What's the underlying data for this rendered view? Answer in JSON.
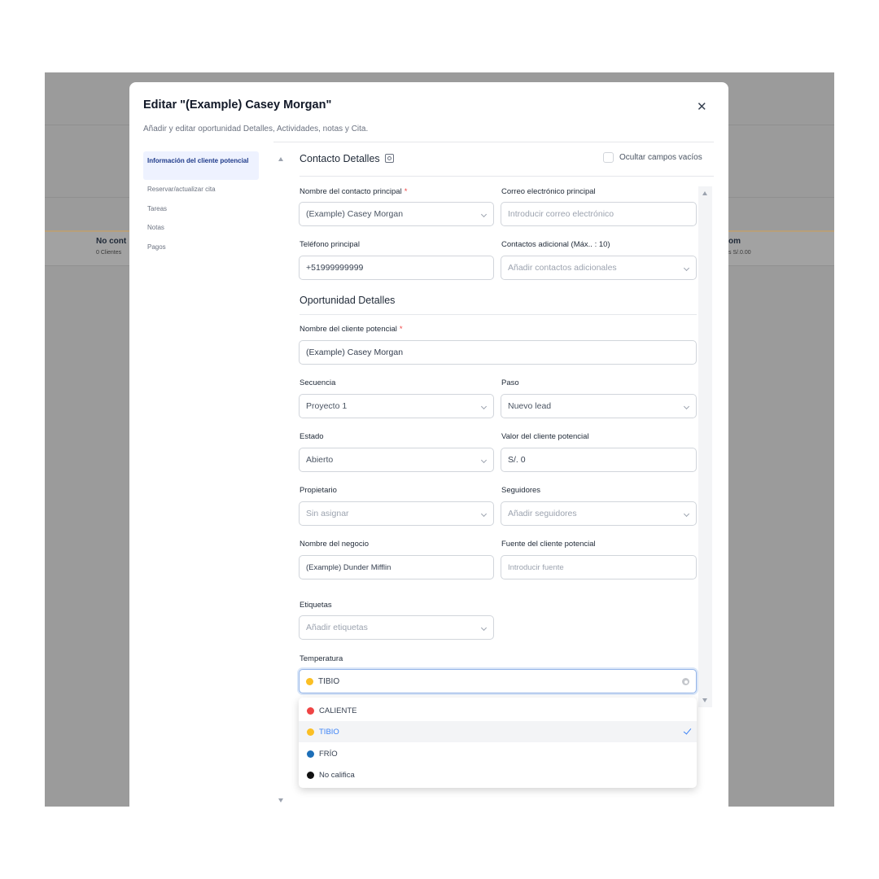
{
  "background": {
    "left_card": {
      "title": "No cont",
      "subtitle": "0 Clientes"
    },
    "right_card": {
      "title": "om",
      "subtitle": "s  S/.0.00"
    }
  },
  "modal": {
    "title": "Editar \"(Example) Casey Morgan\"",
    "subtitle": "Añadir y editar oportunidad Detalles, Actividades, notas y Cita.",
    "close_icon": "close-icon"
  },
  "nav": {
    "items": [
      {
        "label": "Información del cliente potencial",
        "active": true
      },
      {
        "label": "Reservar/actualizar cita"
      },
      {
        "label": "Tareas"
      },
      {
        "label": "Notas"
      },
      {
        "label": "Pagos"
      }
    ]
  },
  "contact_section": {
    "title": "Contacto Detalles",
    "hide_empty_label": "Ocultar campos vacíos",
    "primary_contact": {
      "label": "Nombre del contacto principal",
      "required": "*",
      "value": "(Example) Casey Morgan"
    },
    "primary_email": {
      "label": "Correo electrónico principal",
      "placeholder": "Introducir correo electrónico"
    },
    "primary_phone": {
      "label": "Teléfono principal",
      "value": "+51999999999"
    },
    "additional_contacts": {
      "label": "Contactos adicional (Máx.. : 10)",
      "placeholder": "Añadir contactos adicionales"
    }
  },
  "opportunity_section": {
    "title": "Oportunidad Detalles",
    "lead_name": {
      "label": "Nombre del cliente potencial",
      "required": "*",
      "value": "(Example) Casey Morgan"
    },
    "pipeline": {
      "label": "Secuencia",
      "value": "Proyecto 1"
    },
    "stage": {
      "label": "Paso",
      "value": "Nuevo lead"
    },
    "status": {
      "label": "Estado",
      "value": "Abierto"
    },
    "lead_value": {
      "label": "Valor del cliente potencial",
      "value": "S/. 0"
    },
    "owner": {
      "label": "Propietario",
      "value": "Sin asignar"
    },
    "followers": {
      "label": "Seguidores",
      "placeholder": "Añadir seguidores"
    },
    "business_name": {
      "label": "Nombre del negocio",
      "value": "(Example) Dunder Mifflin"
    },
    "lead_source": {
      "label": "Fuente del cliente potencial",
      "placeholder": "Introducir fuente"
    },
    "tags": {
      "label": "Etiquetas",
      "placeholder": "Añadir etiquetas"
    },
    "temperature": {
      "label": "Temperatura",
      "value": "TIBIO",
      "value_color": "#fbbf24",
      "options": [
        {
          "label": "CALIENTE",
          "color": "#ef4444"
        },
        {
          "label": "TIBIO",
          "color": "#fbbf24",
          "selected": true
        },
        {
          "label": "FRÍO",
          "color": "#1d6fb8"
        },
        {
          "label": "No califica",
          "color": "#111111"
        }
      ]
    }
  }
}
